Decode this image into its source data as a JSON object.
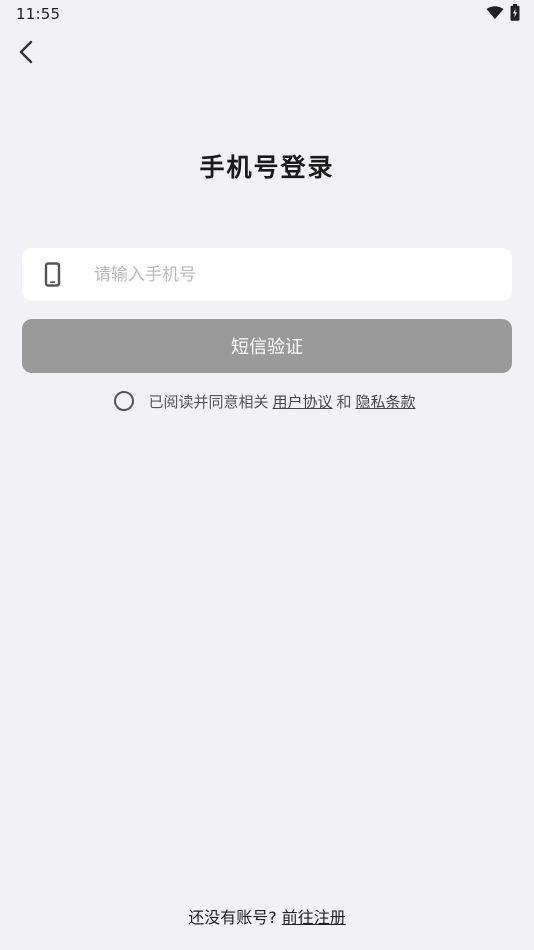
{
  "status_bar": {
    "time": "11:55",
    "icons": [
      "wifi-icon",
      "battery-charging-icon"
    ]
  },
  "header": {
    "back_icon": "chevron-left-icon",
    "title": "手机号登录"
  },
  "phone_input": {
    "icon": "smartphone-icon",
    "placeholder": "请输入手机号",
    "value": ""
  },
  "sms_button": {
    "label": "短信验证"
  },
  "agreement": {
    "checked": false,
    "prefix": "已阅读并同意相关",
    "user_agreement": "用户协议",
    "conjunction": "和",
    "privacy_policy": "隐私条款"
  },
  "footer": {
    "prompt": "还没有账号?",
    "register_link": "前往注册"
  },
  "colors": {
    "background": "#f2f1f6",
    "button_disabled": "#9a9a9a",
    "field_background": "#ffffff",
    "placeholder": "#b9b9be"
  }
}
